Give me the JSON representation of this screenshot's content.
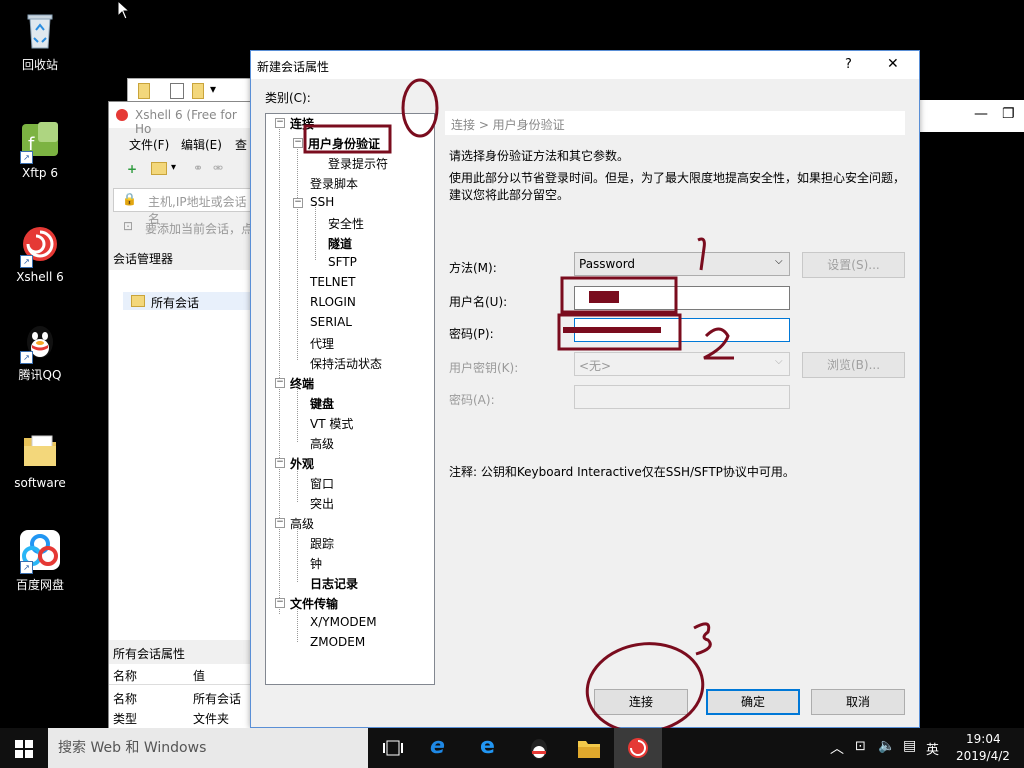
{
  "desktop": {
    "icons": [
      {
        "label": "回收站",
        "icon": "recycle-bin-icon"
      },
      {
        "label": "Xftp 6",
        "icon": "xftp-icon"
      },
      {
        "label": "Xshell 6",
        "icon": "xshell-icon"
      },
      {
        "label": "腾讯QQ",
        "icon": "qq-icon"
      },
      {
        "label": "software",
        "icon": "folder-icon"
      },
      {
        "label": "百度网盘",
        "icon": "baidu-netdisk-icon"
      }
    ]
  },
  "xshell": {
    "title": "Xshell 6 (Free for Ho",
    "menu": [
      "文件(F)",
      "编辑(E)",
      "查"
    ],
    "address_placeholder": "主机,IP地址或会话名",
    "hint": "要添加当前会话，点",
    "session_manager": "会话管理器",
    "all_sessions": "所有会话",
    "props_title": "所有会话属性",
    "props_header": [
      "名称",
      "值"
    ],
    "props_rows": [
      [
        "名称",
        "所有会话"
      ],
      [
        "类型",
        "文件夹"
      ]
    ]
  },
  "dialog": {
    "title": "新建会话属性",
    "help": "?",
    "close": "✕",
    "category_label": "类别(C):",
    "tree": [
      {
        "label": "连接",
        "bold": true
      },
      {
        "label": "用户身份验证",
        "bold": true
      },
      {
        "label": "登录提示符",
        "bold": false
      },
      {
        "label": "登录脚本",
        "bold": false
      },
      {
        "label": "SSH",
        "bold": false
      },
      {
        "label": "安全性",
        "bold": false
      },
      {
        "label": "隧道",
        "bold": true
      },
      {
        "label": "SFTP",
        "bold": false
      },
      {
        "label": "TELNET",
        "bold": false
      },
      {
        "label": "RLOGIN",
        "bold": false
      },
      {
        "label": "SERIAL",
        "bold": false
      },
      {
        "label": "代理",
        "bold": false
      },
      {
        "label": "保持活动状态",
        "bold": false
      },
      {
        "label": "终端",
        "bold": true
      },
      {
        "label": "键盘",
        "bold": true
      },
      {
        "label": "VT 模式",
        "bold": false
      },
      {
        "label": "高级",
        "bold": false
      },
      {
        "label": "外观",
        "bold": true
      },
      {
        "label": "窗口",
        "bold": false
      },
      {
        "label": "突出",
        "bold": false
      },
      {
        "label": "高级",
        "bold": false
      },
      {
        "label": "跟踪",
        "bold": false
      },
      {
        "label": "钟",
        "bold": false
      },
      {
        "label": "日志记录",
        "bold": true
      },
      {
        "label": "文件传输",
        "bold": true
      },
      {
        "label": "X/YMODEM",
        "bold": false
      },
      {
        "label": "ZMODEM",
        "bold": false
      }
    ],
    "breadcrumb": "连接 > 用户身份验证",
    "desc1": "请选择身份验证方法和其它参数。",
    "desc2": "使用此部分以节省登录时间。但是，为了最大限度地提高安全性，如果担心安全问题，",
    "desc3": "建议您将此部分留空。",
    "method_label": "方法(M):",
    "method_value": "Password",
    "settings_btn": "设置(S)...",
    "username_label": "用户名(U):",
    "password_label": "密码(P):",
    "userkey_label": "用户密钥(K):",
    "userkey_value": "<无>",
    "browse_btn": "浏览(B)...",
    "passphrase_label": "密码(A):",
    "note": "注释: 公钥和Keyboard Interactive仅在SSH/SFTP协议中可用。",
    "connect_btn": "连接",
    "ok_btn": "确定",
    "cancel_btn": "取消"
  },
  "annotations": {
    "n0": "0",
    "n1": "1",
    "n2": "2",
    "n3": "3"
  },
  "taskbar": {
    "search_placeholder": "搜索 Web 和 Windows",
    "ime": "英",
    "time": "19:04",
    "date": "2019/4/2"
  },
  "colors": {
    "annotation": "#7a0c1e",
    "accent": "#0078d7",
    "taskbar": "#101010"
  }
}
